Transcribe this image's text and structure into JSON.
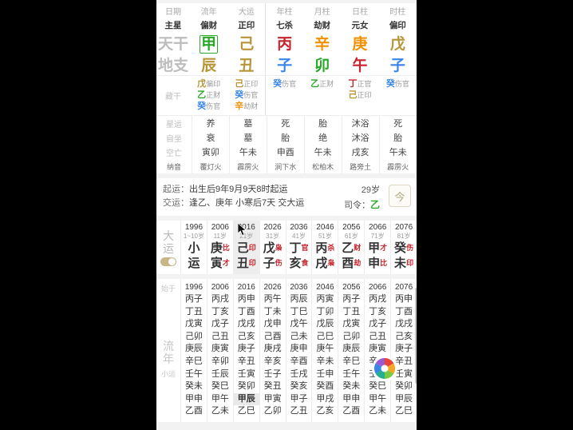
{
  "pillars": {
    "row_labels": [
      "日期",
      "主星",
      "天干",
      "地支"
    ],
    "columns": [
      {
        "head": "流年",
        "star": "偏财",
        "gan": "甲",
        "gan_el": "wood",
        "gan_boxed": true,
        "zhi": "辰",
        "zhi_el": "earth"
      },
      {
        "head": "大运",
        "star": "正印",
        "gan": "己",
        "gan_el": "earth",
        "gan_boxed": false,
        "zhi": "丑",
        "zhi_el": "earth"
      },
      {
        "head": "年柱",
        "star": "七杀",
        "gan": "丙",
        "gan_el": "fire",
        "gan_boxed": false,
        "zhi": "子",
        "zhi_el": "water"
      },
      {
        "head": "月柱",
        "star": "劫财",
        "gan": "辛",
        "gan_el": "metal",
        "gan_boxed": false,
        "zhi": "卯",
        "zhi_el": "wood"
      },
      {
        "head": "日柱",
        "star": "元女",
        "gan": "庚",
        "gan_el": "metal",
        "gan_boxed": false,
        "zhi": "午",
        "zhi_el": "fire"
      },
      {
        "head": "时柱",
        "star": "偏印",
        "gan": "戊",
        "gan_el": "earth",
        "gan_boxed": false,
        "zhi": "子",
        "zhi_el": "water"
      }
    ]
  },
  "hidden": {
    "label": "藏干",
    "columns": [
      [
        {
          "gan": "戊",
          "el": "earth",
          "god": "偏印"
        },
        {
          "gan": "乙",
          "el": "wood",
          "god": "正财"
        },
        {
          "gan": "癸",
          "el": "water",
          "god": "伤官"
        }
      ],
      [
        {
          "gan": "己",
          "el": "earth",
          "god": "正印"
        },
        {
          "gan": "癸",
          "el": "water",
          "god": "伤官"
        },
        {
          "gan": "辛",
          "el": "metal",
          "god": "劫财"
        }
      ],
      [
        {
          "gan": "癸",
          "el": "water",
          "god": "伤官"
        }
      ],
      [
        {
          "gan": "乙",
          "el": "wood",
          "god": "正财"
        }
      ],
      [
        {
          "gan": "丁",
          "el": "fire",
          "god": "正官"
        },
        {
          "gan": "己",
          "el": "earth",
          "god": "正印"
        }
      ],
      [
        {
          "gan": "癸",
          "el": "water",
          "god": "伤官"
        }
      ]
    ]
  },
  "fortune": {
    "rows": [
      {
        "label": "星运",
        "values": [
          "养",
          "墓",
          "死",
          "胎",
          "沐浴",
          "死"
        ],
        "small": false
      },
      {
        "label": "自坐",
        "values": [
          "衰",
          "墓",
          "胎",
          "绝",
          "沐浴",
          "胎"
        ],
        "small": false
      },
      {
        "label": "空亡",
        "values": [
          "寅卯",
          "午未",
          "申酉",
          "午未",
          "戌亥",
          "午未"
        ],
        "small": false
      },
      {
        "label": "纳音",
        "values": [
          "覆灯火",
          "霹雳火",
          "涧下水",
          "松柏木",
          "路旁土",
          "霹雳火"
        ],
        "small": true
      }
    ]
  },
  "info": {
    "qiyun_key": "起运：",
    "qiyun_val": "出生后9年9月9天8时起运",
    "jiaoyun_key": "交运：",
    "jiaoyun_val": "逢乙、庚年 小寒后7天 交大运",
    "age": "29岁",
    "siling_key": "司令：",
    "siling_val": "乙",
    "today_button": "今"
  },
  "dayun": {
    "label_top": "大",
    "label_bottom": "运",
    "toggle_on": true,
    "columns": [
      {
        "year": "1996",
        "age": "1~10岁",
        "gan": "小",
        "gan_god": "",
        "zhi": "运",
        "zhi_god": "",
        "selected": false,
        "plain": true
      },
      {
        "year": "2006",
        "age": "11岁",
        "gan": "庚",
        "gan_god": "比",
        "zhi": "寅",
        "zhi_god": "才",
        "selected": false,
        "plain": false
      },
      {
        "year": "2016",
        "age": "21岁",
        "gan": "己",
        "gan_god": "印",
        "zhi": "丑",
        "zhi_god": "印",
        "selected": true,
        "plain": false
      },
      {
        "year": "2026",
        "age": "31岁",
        "gan": "戊",
        "gan_god": "枭",
        "zhi": "子",
        "zhi_god": "伤",
        "selected": false,
        "plain": false
      },
      {
        "year": "2036",
        "age": "41岁",
        "gan": "丁",
        "gan_god": "官",
        "zhi": "亥",
        "zhi_god": "食",
        "selected": false,
        "plain": false
      },
      {
        "year": "2046",
        "age": "51岁",
        "gan": "丙",
        "gan_god": "杀",
        "zhi": "戌",
        "zhi_god": "枭",
        "selected": false,
        "plain": false
      },
      {
        "year": "2056",
        "age": "61岁",
        "gan": "乙",
        "gan_god": "财",
        "zhi": "酉",
        "zhi_god": "劫",
        "selected": false,
        "plain": false
      },
      {
        "year": "2066",
        "age": "71岁",
        "gan": "甲",
        "gan_god": "才",
        "zhi": "申",
        "zhi_god": "比",
        "selected": false,
        "plain": false
      },
      {
        "year": "2076",
        "age": "81岁",
        "gan": "癸",
        "gan_god": "伤",
        "zhi": "未",
        "zhi_god": "印",
        "selected": false,
        "plain": false
      }
    ]
  },
  "liunian": {
    "label_top": "始于",
    "label_big_1": "流",
    "label_big_2": "年",
    "label_sub": "小运",
    "years": [
      "1996",
      "2006",
      "2016",
      "2026",
      "2036",
      "2046",
      "2056",
      "2066",
      "2076"
    ],
    "selected_cell": {
      "col": 2,
      "row": 8
    },
    "columns": [
      [
        "丙子",
        "丁丑",
        "戊寅",
        "己卯",
        "庚辰",
        "辛巳",
        "壬午",
        "癸未",
        "甲申",
        "乙酉"
      ],
      [
        "丙戌",
        "丁亥",
        "戊子",
        "己丑",
        "庚寅",
        "辛卯",
        "壬辰",
        "癸巳",
        "甲午",
        "乙未"
      ],
      [
        "丙申",
        "丁酉",
        "戊戌",
        "己亥",
        "庚子",
        "辛丑",
        "壬寅",
        "癸卯",
        "甲辰",
        "乙巳"
      ],
      [
        "丙午",
        "丁未",
        "戊申",
        "己酉",
        "庚戌",
        "辛亥",
        "壬子",
        "癸丑",
        "甲寅",
        "乙卯"
      ],
      [
        "丙辰",
        "丁巳",
        "戊午",
        "己未",
        "庚申",
        "辛酉",
        "壬戌",
        "癸亥",
        "甲子",
        "乙丑"
      ],
      [
        "丙寅",
        "丁卯",
        "戊辰",
        "己巳",
        "庚午",
        "辛未",
        "壬申",
        "癸酉",
        "甲戌",
        "乙亥"
      ],
      [
        "丙子",
        "丁丑",
        "戊寅",
        "己卯",
        "庚辰",
        "辛巳",
        "壬午",
        "癸未",
        "甲申",
        "乙酉"
      ],
      [
        "丙戌",
        "丁亥",
        "戊子",
        "己丑",
        "庚寅",
        "辛卯",
        "壬辰",
        "癸巳",
        "甲午",
        "乙未"
      ],
      [
        "丙申",
        "丁酉",
        "戊戌",
        "己亥",
        "庚子",
        "辛丑",
        "壬寅",
        "癸卯",
        "甲辰",
        "乙巳"
      ]
    ]
  },
  "floating": {
    "wheel_icon": "color-wheel-icon"
  }
}
